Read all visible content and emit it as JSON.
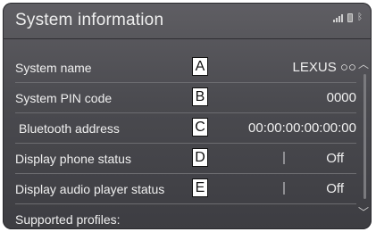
{
  "header": {
    "title": "System information"
  },
  "status_icons": [
    "signal-icon",
    "battery-icon",
    "bluetooth-icon"
  ],
  "rows": [
    {
      "label": "System name",
      "value": "LEXUS ○○",
      "badge": "A"
    },
    {
      "label": "System PIN code",
      "value": "0000",
      "badge": "B"
    },
    {
      "label": "Bluetooth address",
      "value": "00:00:00:00:00:00",
      "badge": "C"
    },
    {
      "label": "Display phone status",
      "value": "Off",
      "badge": "D"
    },
    {
      "label": "Display audio player status",
      "value": "Off",
      "badge": "E"
    },
    {
      "label": "Supported profiles:",
      "value": ""
    }
  ],
  "colors": {
    "background": "#4a4a4f",
    "text": "#efefef",
    "divider": "#6c6c70",
    "badge_bg": "#ffffff"
  }
}
